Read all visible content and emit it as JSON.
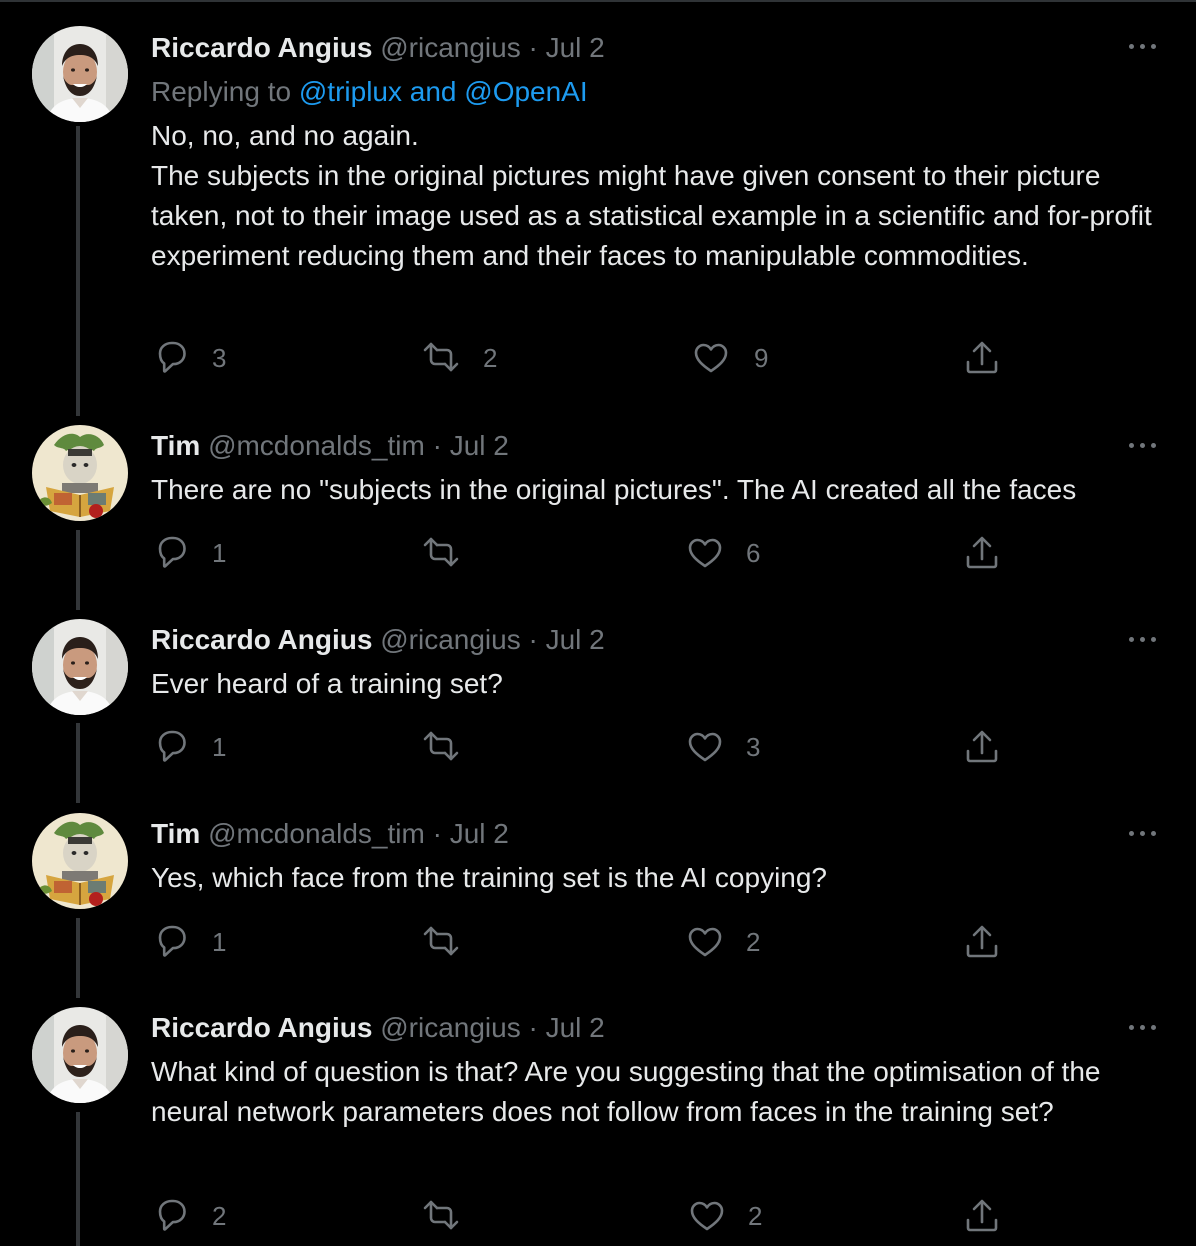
{
  "thread": [
    {
      "avatar": "riccardo-avatar",
      "name": "Riccardo Angius",
      "handle": "@ricangius",
      "separator": "·",
      "date": "Jul 2",
      "replying_label": "Replying to",
      "replying_to": "@triplux and @OpenAI",
      "lines": [
        "No, no, and no again.",
        "The subjects in the original pictures might have given consent to their picture taken, not to their image used as a statistical example in a scientific and for-profit experiment reducing them and their faces to manipulable commodities."
      ],
      "replies": "3",
      "retweets": "2",
      "likes": "9"
    },
    {
      "avatar": "tim-avatar",
      "name": "Tim",
      "handle": "@mcdonalds_tim",
      "separator": "·",
      "date": "Jul 2",
      "lines": [
        "There are no \"subjects in the original pictures\". The AI created all the faces"
      ],
      "replies": "1",
      "retweets": "",
      "likes": "6"
    },
    {
      "avatar": "riccardo-avatar",
      "name": "Riccardo Angius",
      "handle": "@ricangius",
      "separator": "·",
      "date": "Jul 2",
      "lines": [
        "Ever heard of a training set?"
      ],
      "replies": "1",
      "retweets": "",
      "likes": "3"
    },
    {
      "avatar": "tim-avatar",
      "name": "Tim",
      "handle": "@mcdonalds_tim",
      "separator": "·",
      "date": "Jul 2",
      "lines": [
        "Yes, which face from the training set is the AI copying?"
      ],
      "replies": "1",
      "retweets": "",
      "likes": "2"
    },
    {
      "avatar": "riccardo-avatar",
      "name": "Riccardo Angius",
      "handle": "@ricangius",
      "separator": "·",
      "date": "Jul 2",
      "lines": [
        "What kind of question is that? Are you suggesting that the optimisation of the neural network parameters does not follow from faces in the training set?"
      ],
      "replies": "2",
      "retweets": "",
      "likes": "2"
    }
  ],
  "icons": {
    "reply": "reply-icon",
    "retweet": "retweet-icon",
    "like": "heart-icon",
    "share": "share-icon",
    "more": "more-icon"
  },
  "colors": {
    "background": "#000000",
    "text": "#e7e9ea",
    "secondary": "#71767b",
    "link": "#1d9bf0",
    "thread_line": "#333639"
  }
}
